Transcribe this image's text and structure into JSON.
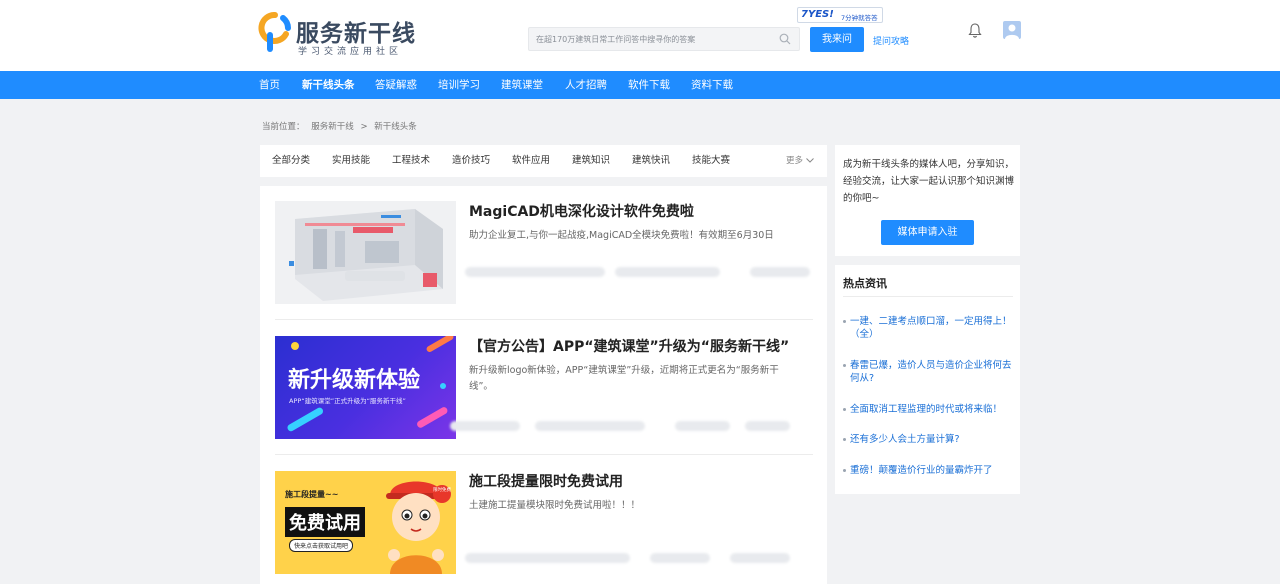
{
  "header": {
    "logo_title": "服务新干线",
    "logo_subtitle": "学习交流应用社区",
    "search_placeholder": "在超170万建筑日常工作问答中搜寻你的答案",
    "ask_button": "我来问",
    "ask_tips": "提问攻略",
    "badge_yes": "7YES!",
    "badge_text": "7分钟就答答",
    "brand_color": "#1f8cff"
  },
  "nav": {
    "items": [
      {
        "label": "首页"
      },
      {
        "label": "新干线头条",
        "active": true
      },
      {
        "label": "答疑解惑"
      },
      {
        "label": "培训学习"
      },
      {
        "label": "建筑课堂"
      },
      {
        "label": "人才招聘"
      },
      {
        "label": "软件下载"
      },
      {
        "label": "资料下载"
      }
    ]
  },
  "breadcrumb": {
    "prefix": "当前位置：",
    "items": [
      "服务新干线",
      ">",
      "新干线头条"
    ]
  },
  "categories": {
    "items": [
      "全部分类",
      "实用技能",
      "工程技术",
      "造价技巧",
      "软件应用",
      "建筑知识",
      "建筑快讯",
      "技能大赛"
    ],
    "more": "更多"
  },
  "articles": [
    {
      "title": "MagiCAD机电深化设计软件免费啦",
      "desc": "助力企业复工,与你一起战疫,MagiCAD全模块免费啦！有效期至6月30日",
      "thumb": "magicad-building-render"
    },
    {
      "title": "【官方公告】APP“建筑课堂”升级为“服务新干线”",
      "desc": "新升级新logo新体验，APP“建筑课堂”升级，近期将正式更名为“服务新干线”。",
      "thumb": "upgrade-banner",
      "thumb_text": "新升级新体验",
      "thumb_sub": "APP“建筑课堂”正式升级为“服务新干线”"
    },
    {
      "title": "施工段提量限时免费试用",
      "desc": "土建施工提量模块限时免费试用啦！！！",
      "thumb": "free-trial-cartoon",
      "thumb_text1": "施工段提量~~",
      "thumb_text2": "免费试用",
      "thumb_text3": "快来点击获取试用吧",
      "thumb_badge": "限时免费"
    }
  ],
  "sidebar": {
    "join_text": "成为新干线头条的媒体人吧，分享知识，经验交流，让大家一起认识那个知识渊博的你吧~",
    "join_button": "媒体申请入驻",
    "hot_title": "热点资讯",
    "hot_items": [
      "一建、二建考点顺口溜，一定用得上！（全）",
      "春雷已爆，造价人员与造价企业将何去何从?",
      "全面取消工程监理的时代或将来临！",
      "还有多少人会土方量计算?",
      "重磅！颠覆造价行业的量霸炸开了"
    ]
  }
}
